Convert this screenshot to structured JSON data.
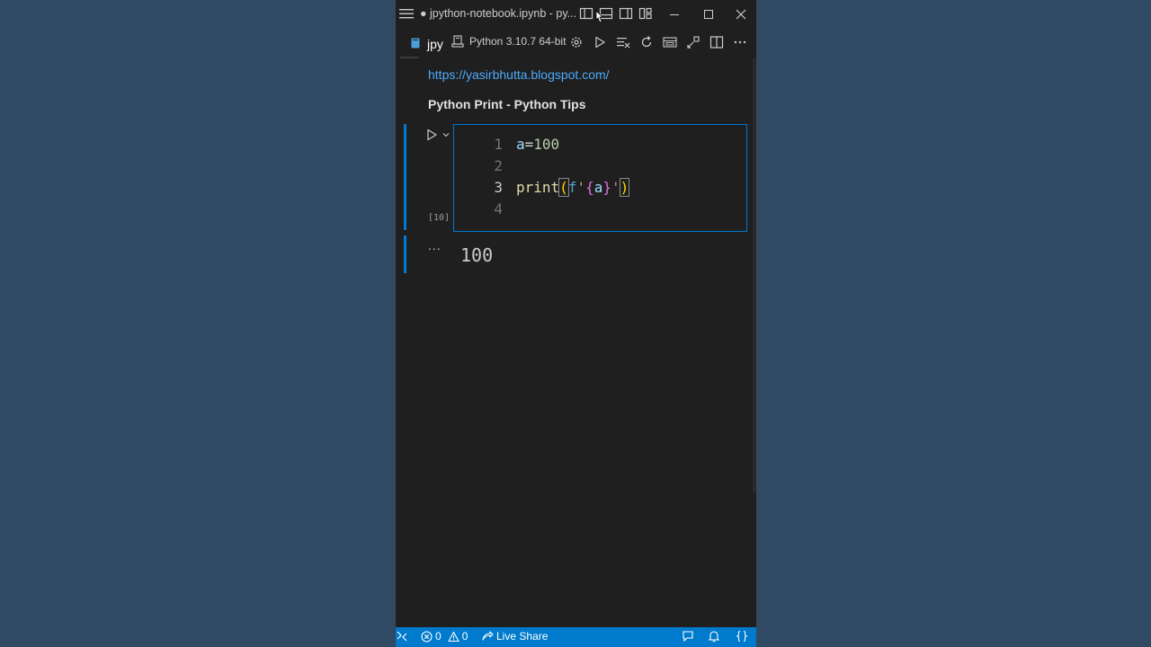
{
  "window": {
    "title": "● jpython-notebook.ipynb - py..."
  },
  "tab": {
    "label": "jpy"
  },
  "kernel": {
    "label": "Python 3.10.7 64-bit"
  },
  "markdown": {
    "link": "https://yasirbhutta.blogspot.com/",
    "heading": "Python Print - Python Tips"
  },
  "cell": {
    "execution_count": "[10]",
    "line_numbers": [
      "1",
      "2",
      "3",
      "4"
    ],
    "line1": {
      "var": "a",
      "op": "=",
      "num": "100"
    },
    "line3": {
      "fn": "print",
      "open": "(",
      "fprefix": "f",
      "q1": "'",
      "bo": "{",
      "var": "a",
      "bc": "}",
      "q2": "'",
      "close": ")"
    }
  },
  "output": {
    "more_label": "...",
    "text": "100"
  },
  "statusbar": {
    "errors": "0",
    "warnings": "0",
    "live_share": "Live Share"
  },
  "colors": {
    "accent": "#0078d4",
    "statusbar": "#007acc",
    "link": "#4daafc",
    "background": "#1f1f1f"
  },
  "icons": {
    "menu": "hamburger-icon",
    "run": "play-icon",
    "settings": "gear-icon",
    "bell": "bell-icon"
  }
}
